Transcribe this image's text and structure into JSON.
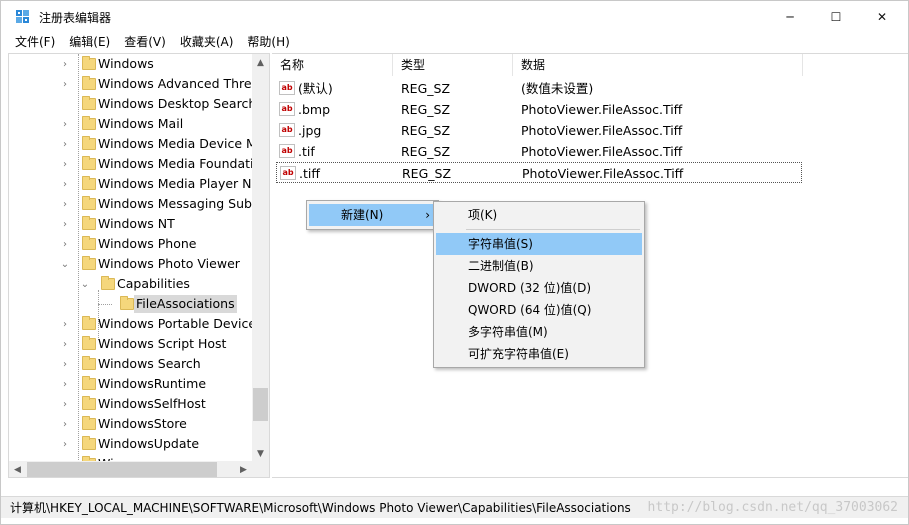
{
  "window": {
    "title": "注册表编辑器",
    "app_icon": "regedit-icon",
    "controls": {
      "minimize": "─",
      "maximize": "☐",
      "close": "✕"
    }
  },
  "menubar": {
    "items": [
      "文件(F)",
      "编辑(E)",
      "查看(V)",
      "收藏夹(A)",
      "帮助(H)"
    ]
  },
  "tree": {
    "items": [
      {
        "label": "Windows",
        "expander": "›"
      },
      {
        "label": "Windows Advanced Threat",
        "expander": "›"
      },
      {
        "label": "Windows Desktop Search",
        "expander": ""
      },
      {
        "label": "Windows Mail",
        "expander": "›"
      },
      {
        "label": "Windows Media Device M",
        "expander": "›"
      },
      {
        "label": "Windows Media Foundatic",
        "expander": "›"
      },
      {
        "label": "Windows Media Player NS",
        "expander": "›"
      },
      {
        "label": "Windows Messaging Subs",
        "expander": "›"
      },
      {
        "label": "Windows NT",
        "expander": "›"
      },
      {
        "label": "Windows Phone",
        "expander": "›"
      },
      {
        "label": "Windows Photo Viewer",
        "expander": "⌄"
      },
      {
        "label": "Capabilities",
        "expander": "⌄"
      },
      {
        "label": "FileAssociations",
        "expander": ""
      },
      {
        "label": "Windows Portable Devices",
        "expander": "›"
      },
      {
        "label": "Windows Script Host",
        "expander": "›"
      },
      {
        "label": "Windows Search",
        "expander": "›"
      },
      {
        "label": "WindowsRuntime",
        "expander": "›"
      },
      {
        "label": "WindowsSelfHost",
        "expander": "›"
      },
      {
        "label": "WindowsStore",
        "expander": "›"
      },
      {
        "label": "WindowsUpdate",
        "expander": "›"
      },
      {
        "label": "Wisp",
        "expander": "›"
      }
    ],
    "selected": "FileAssociations"
  },
  "values": {
    "headers": {
      "name": "名称",
      "type": "类型",
      "data": "数据"
    },
    "rows": [
      {
        "name": "(默认)",
        "type": "REG_SZ",
        "data": "(数值未设置)"
      },
      {
        "name": ".bmp",
        "type": "REG_SZ",
        "data": "PhotoViewer.FileAssoc.Tiff"
      },
      {
        "name": ".jpg",
        "type": "REG_SZ",
        "data": "PhotoViewer.FileAssoc.Tiff"
      },
      {
        "name": ".tif",
        "type": "REG_SZ",
        "data": "PhotoViewer.FileAssoc.Tiff"
      },
      {
        "name": ".tiff",
        "type": "REG_SZ",
        "data": "PhotoViewer.FileAssoc.Tiff"
      }
    ],
    "icon_text": "ab"
  },
  "context_menu": {
    "new_label": "新建(N)",
    "submenu_arrow": "›"
  },
  "submenu": {
    "items": [
      "项(K)",
      "字符串值(S)",
      "二进制值(B)",
      "DWORD (32 位)值(D)",
      "QWORD (64 位)值(Q)",
      "多字符串值(M)",
      "可扩充字符串值(E)"
    ],
    "highlighted": "字符串值(S)"
  },
  "statusbar": {
    "path": "计算机\\HKEY_LOCAL_MACHINE\\SOFTWARE\\Microsoft\\Windows Photo Viewer\\Capabilities\\FileAssociations",
    "watermark": "http://blog.csdn.net/qq_37003062"
  },
  "colors": {
    "highlight": "#91c9f7",
    "tree_selected": "#d9d9d9",
    "folder": "#f5d77c"
  }
}
